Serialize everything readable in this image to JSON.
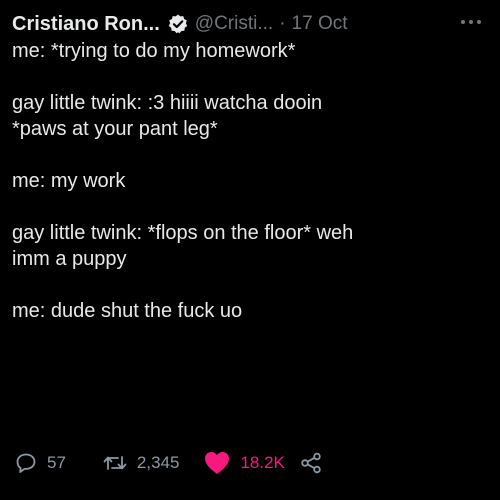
{
  "tweet": {
    "display_name": "Cristiano Ron...",
    "handle": "@Cristi...",
    "separator": "·",
    "date": "17 Oct",
    "lines": [
      "me: *trying to do my homework*",
      "",
      "gay little twink: :3 hiiii watcha dooin",
      "*paws at your pant leg*",
      "",
      "me: my work",
      "",
      "gay little twink: *flops on the floor* weh",
      "imm a puppy",
      "",
      "me: dude shut the fuck uo"
    ],
    "replies": "57",
    "retweets": "2,345",
    "likes": "18.2K",
    "liked": true
  },
  "icons": {
    "verified": "verified-badge-icon",
    "more": "more-dots-icon",
    "reply": "reply-bubble-icon",
    "retweet": "retweet-icon",
    "like": "heart-icon",
    "share": "share-icon"
  },
  "colors": {
    "background": "#000000",
    "text": "#e7e9ea",
    "secondary": "#71767b",
    "like": "#f91880"
  }
}
